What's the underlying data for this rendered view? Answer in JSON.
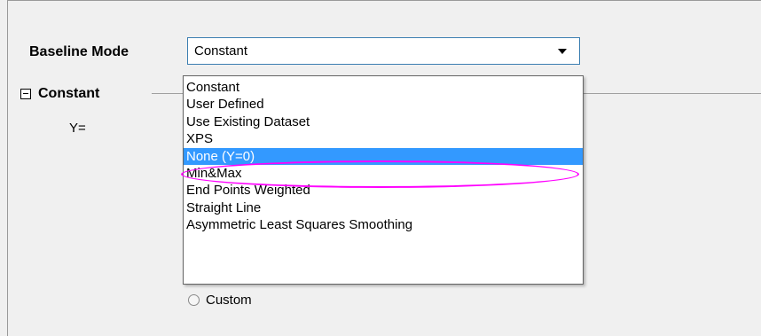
{
  "baseline_mode": {
    "label": "Baseline Mode",
    "selected_value": "Constant"
  },
  "section": {
    "title": "Constant",
    "y_label": "Y="
  },
  "dropdown": {
    "options": [
      "Constant",
      "User Defined",
      "Use Existing Dataset",
      "XPS",
      "None (Y=0)",
      "Min&Max",
      "End Points Weighted",
      "Straight Line",
      "Asymmetric Least Squares Smoothing"
    ],
    "highlighted": "None (Y=0)"
  },
  "custom_option": {
    "label": "Custom"
  },
  "colors": {
    "highlight_fill": "#3399ff",
    "annotation_outline": "#ff00ff",
    "combo_border": "#3c7fb1"
  }
}
